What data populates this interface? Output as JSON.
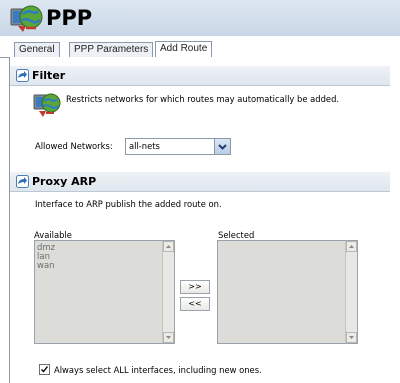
{
  "header": {
    "title": "PPP",
    "icon": "network-globe-icon"
  },
  "tabs": [
    {
      "label": "General",
      "active": false
    },
    {
      "label": "PPP Parameters",
      "active": false
    },
    {
      "label": "Add Route",
      "active": true
    }
  ],
  "filter": {
    "heading": "Filter",
    "description": "Restricts networks for which routes may automatically be added.",
    "allowed_label": "Allowed Networks:",
    "allowed_value": "all-nets"
  },
  "proxy_arp": {
    "heading": "Proxy ARP",
    "description": "Interface to ARP publish the added route on.",
    "available_label": "Available",
    "selected_label": "Selected",
    "available_items": [
      "dmz",
      "lan",
      "wan"
    ],
    "selected_items": [],
    "add_button": ">>",
    "remove_button": "<<",
    "always_select_label": "Always select ALL interfaces, including new ones.",
    "always_select_checked": true
  },
  "colors": {
    "header_bg": "#c8d7e7",
    "list_bg": "#dcdcd8",
    "accent": "#2a6fb8"
  }
}
